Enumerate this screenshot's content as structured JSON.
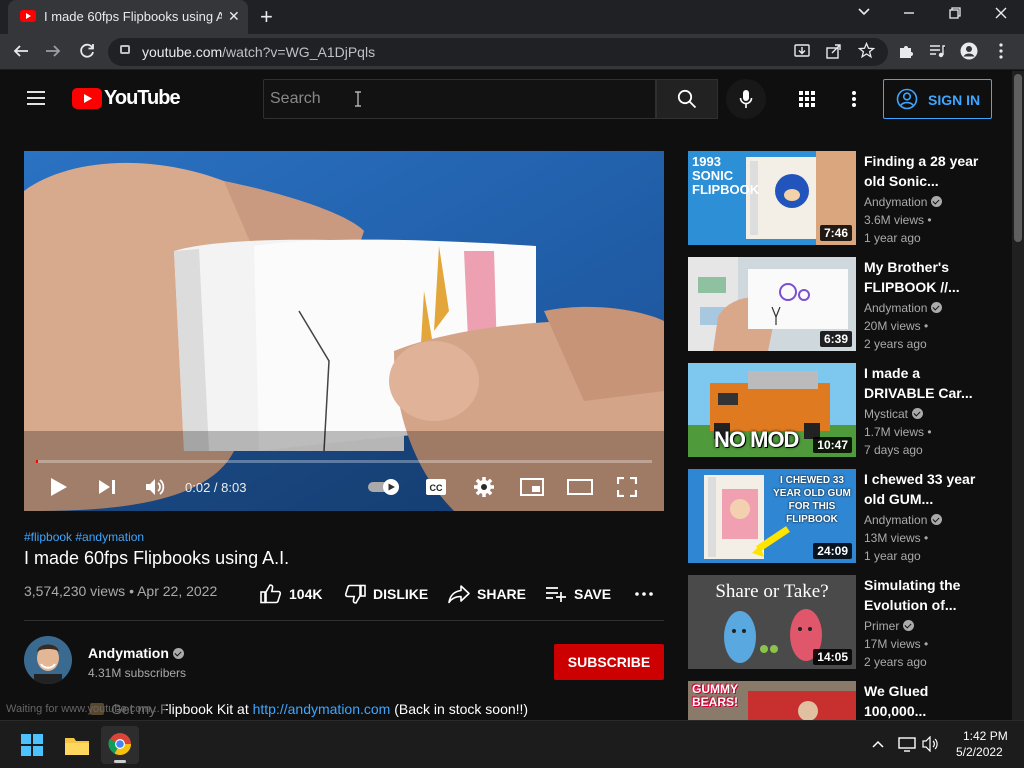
{
  "browser": {
    "tab_title": "I made 60fps Flipbooks using A.I.",
    "tab_close": "✕",
    "new_tab": "+",
    "url_host": "youtube.com",
    "url_path": "/watch?v=WG_A1DjPqls"
  },
  "header": {
    "logo_text": "YouTube",
    "search_placeholder": "Search",
    "sign_in_label": "SIGN IN"
  },
  "player": {
    "time_label": "0:02 / 8:03",
    "progress_fraction": 0.004
  },
  "video": {
    "hashtags": "#flipbook #andymation",
    "title": "I made 60fps Flipbooks using A.I.",
    "stats": "3,574,230 views • Apr 22, 2022",
    "like_label": "104K",
    "dislike_label": "DISLIKE",
    "share_label": "SHARE",
    "save_label": "SAVE"
  },
  "channel": {
    "name": "Andymation",
    "subscribers": "4.31M subscribers",
    "subscribe_label": "SUBSCRIBE"
  },
  "description": {
    "prefix": "Get my Flipbook Kit at ",
    "link": "http://andymation.com",
    "suffix": " (Back in stock soon!!)"
  },
  "status_text": "Waiting for www.youtube.com...",
  "recommendations": [
    {
      "title": "Finding a 28 year old Sonic...",
      "channel": "Andymation",
      "views": "3.6M views •",
      "age": "1 year ago",
      "duration": "7:46",
      "thumb_text": "1993 SONIC FLIPBOOK"
    },
    {
      "title": "My Brother's FLIPBOOK //...",
      "channel": "Andymation",
      "views": "20M views •",
      "age": "2 years ago",
      "duration": "6:39",
      "thumb_text": ""
    },
    {
      "title": "I made a DRIVABLE Car...",
      "channel": "Mysticat",
      "views": "1.7M views •",
      "age": "7 days ago",
      "duration": "10:47",
      "thumb_text": "NO MOD"
    },
    {
      "title": "I chewed 33 year old GUM...",
      "channel": "Andymation",
      "views": "13M views •",
      "age": "1 year ago",
      "duration": "24:09",
      "thumb_text": "I CHEWED 33 YEAR OLD GUM FOR THIS FLIPBOOK"
    },
    {
      "title": "Simulating the Evolution of...",
      "channel": "Primer",
      "views": "17M views •",
      "age": "2 years ago",
      "duration": "14:05",
      "thumb_text": "Share or Take?"
    },
    {
      "title": "We Glued 100,000...",
      "channel": "",
      "views": "",
      "age": "",
      "duration": "",
      "thumb_text": "GUMMY BEARS!"
    }
  ],
  "taskbar": {
    "time": "1:42 PM",
    "date": "5/2/2022"
  },
  "colors": {
    "youtube_red": "#ff0000",
    "link_blue": "#3ea6ff",
    "subscribe_red": "#cc0000",
    "background": "#0f0f0f"
  }
}
